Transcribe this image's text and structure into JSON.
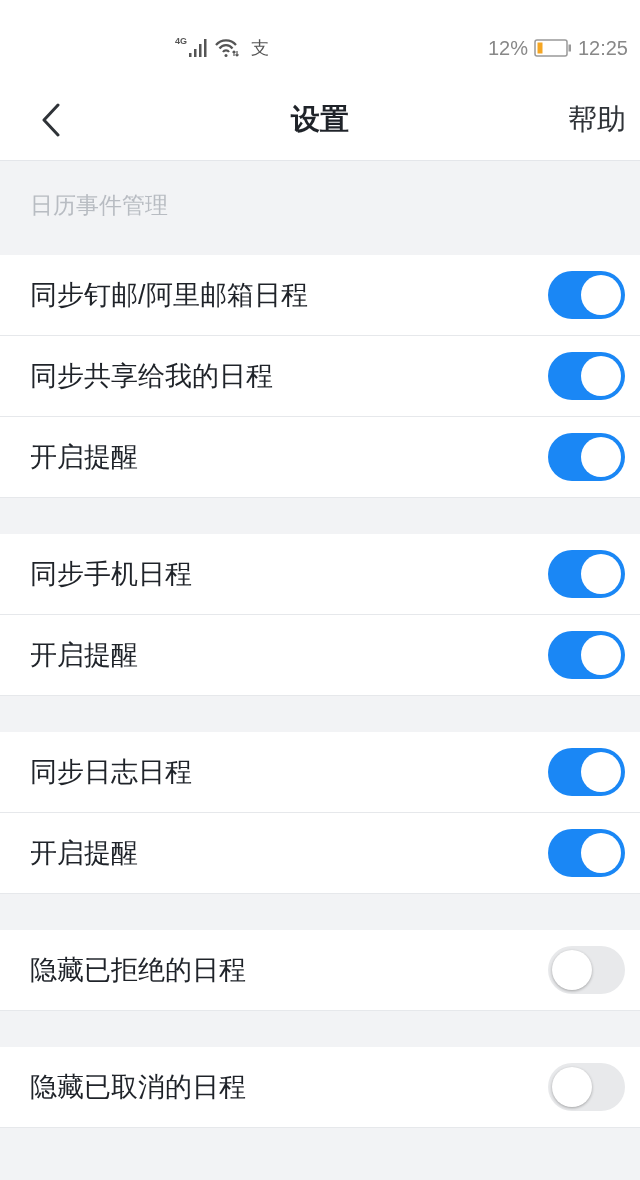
{
  "status_bar": {
    "network": "4G",
    "notification": "支",
    "battery": "12%",
    "time": "12:25"
  },
  "header": {
    "title": "设置",
    "action": "帮助"
  },
  "section": {
    "label": "日历事件管理"
  },
  "groups": [
    {
      "items": [
        {
          "label": "同步钉邮/阿里邮箱日程",
          "on": true
        },
        {
          "label": "同步共享给我的日程",
          "on": true
        },
        {
          "label": "开启提醒",
          "on": true
        }
      ]
    },
    {
      "items": [
        {
          "label": "同步手机日程",
          "on": true
        },
        {
          "label": "开启提醒",
          "on": true
        }
      ]
    },
    {
      "items": [
        {
          "label": "同步日志日程",
          "on": true
        },
        {
          "label": "开启提醒",
          "on": true
        }
      ]
    },
    {
      "items": [
        {
          "label": "隐藏已拒绝的日程",
          "on": false
        }
      ]
    },
    {
      "items": [
        {
          "label": "隐藏已取消的日程",
          "on": false
        }
      ]
    }
  ]
}
